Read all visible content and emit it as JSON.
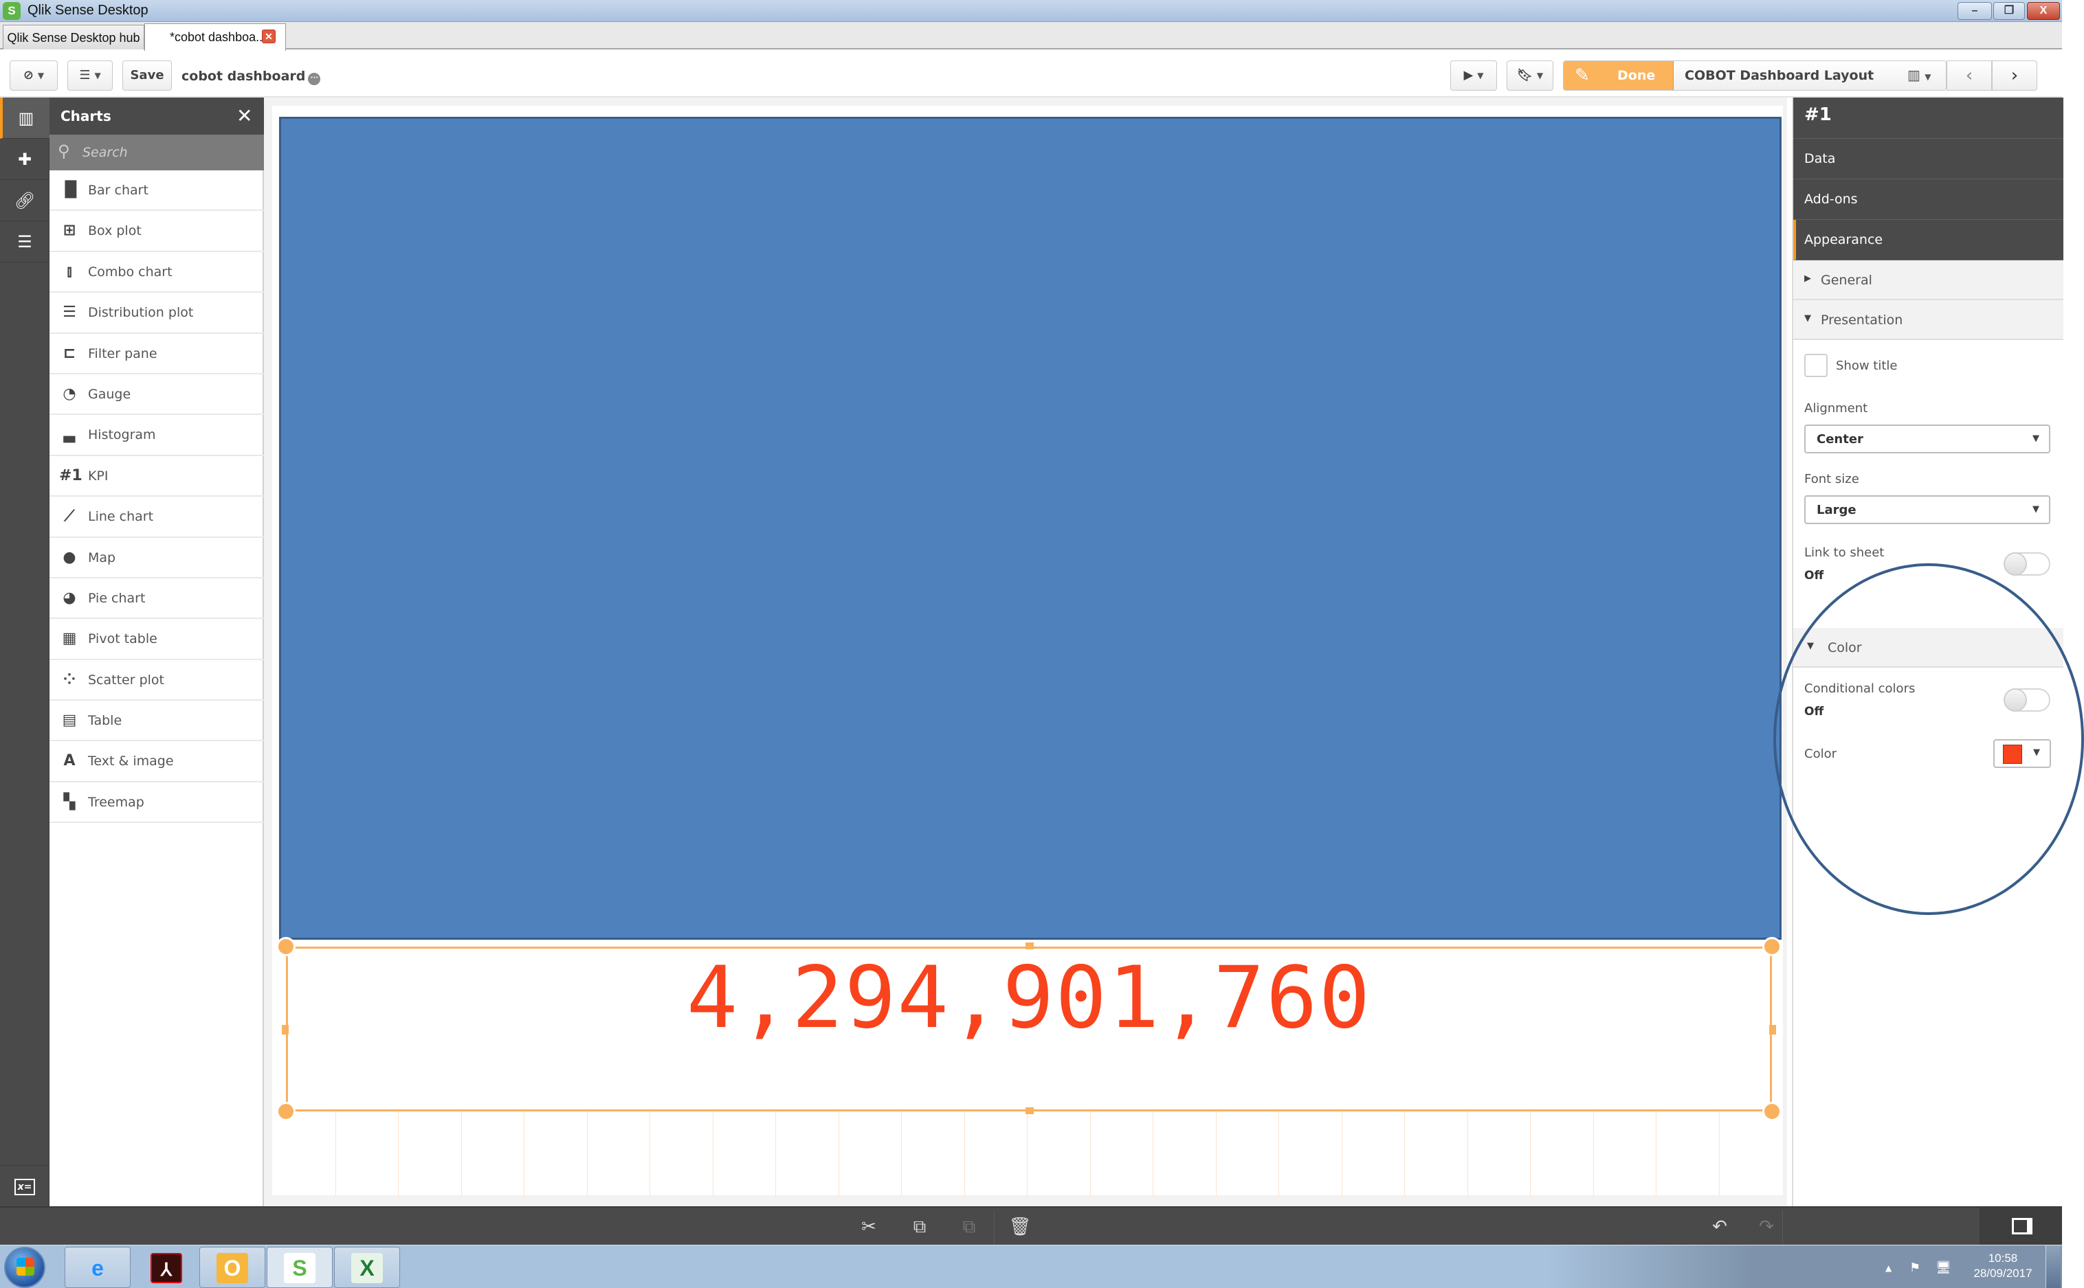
{
  "window": {
    "title": "Qlik Sense Desktop",
    "controls": {
      "minimize": "–",
      "restore": "❐",
      "close": "X"
    }
  },
  "tabs": [
    {
      "label": "Qlik Sense Desktop hub",
      "active": false
    },
    {
      "label": "*cobot dashboa...",
      "active": true,
      "close": "✕"
    }
  ],
  "toolbar": {
    "save_label": "Save",
    "app_name": "cobot dashboard",
    "app_info_icon": "···",
    "done_label": "Done",
    "sheet_title": "COBOT Dashboard Layout",
    "prev_label": "‹",
    "next_label": "›"
  },
  "icon_bar": {
    "items": [
      {
        "name": "charts",
        "active": true
      },
      {
        "name": "extensions",
        "active": false
      },
      {
        "name": "master-items",
        "active": false
      },
      {
        "name": "fields",
        "active": false
      }
    ],
    "bottom": "x="
  },
  "charts_panel": {
    "title": "Charts",
    "close_icon": "✕",
    "search_placeholder": "Search",
    "items": [
      {
        "label": "Bar chart",
        "icon": "▐▌"
      },
      {
        "label": "Box plot",
        "icon": "⊞"
      },
      {
        "label": "Combo chart",
        "icon": "⫾"
      },
      {
        "label": "Distribution plot",
        "icon": "☰"
      },
      {
        "label": "Filter pane",
        "icon": "⊏"
      },
      {
        "label": "Gauge",
        "icon": "◔"
      },
      {
        "label": "Histogram",
        "icon": "▃"
      },
      {
        "label": "KPI",
        "icon": "#1"
      },
      {
        "label": "Line chart",
        "icon": "⟋"
      },
      {
        "label": "Map",
        "icon": "●"
      },
      {
        "label": "Pie chart",
        "icon": "◕"
      },
      {
        "label": "Pivot table",
        "icon": "▦"
      },
      {
        "label": "Scatter plot",
        "icon": "⁘"
      },
      {
        "label": "Table",
        "icon": "▤"
      },
      {
        "label": "Text & image",
        "icon": "A"
      },
      {
        "label": "Treemap",
        "icon": "▚"
      }
    ]
  },
  "canvas": {
    "shape_color": "#4f81bd",
    "kpi": {
      "value": "4,294,901,760",
      "color": "#f8431c"
    }
  },
  "properties": {
    "object_title": "#1",
    "tabs": [
      {
        "label": "Data",
        "active": false
      },
      {
        "label": "Add-ons",
        "active": false
      },
      {
        "label": "Appearance",
        "active": true
      }
    ],
    "sections": {
      "general": "General",
      "presentation": "Presentation",
      "color": "Color"
    },
    "show_title": {
      "label": "Show title",
      "checked": false
    },
    "alignment": {
      "label": "Alignment",
      "value": "Center"
    },
    "font_size": {
      "label": "Font size",
      "value": "Large"
    },
    "link_to_sheet": {
      "label": "Link to sheet",
      "state": "Off"
    },
    "conditional_colors": {
      "label": "Conditional colors",
      "state": "Off"
    },
    "color": {
      "label": "Color",
      "value": "#f8431c"
    }
  },
  "bottom_toolbar": {
    "cut": "✂",
    "copy": "⧉",
    "paste": "⧉",
    "delete": "🗑",
    "undo": "↶",
    "redo": "↷"
  },
  "taskbar": {
    "apps": [
      "Internet Explorer",
      "Adobe Acrobat",
      "Outlook",
      "Qlik Sense",
      "Excel"
    ],
    "clock_time": "10:58",
    "clock_date": "28/09/2017"
  }
}
